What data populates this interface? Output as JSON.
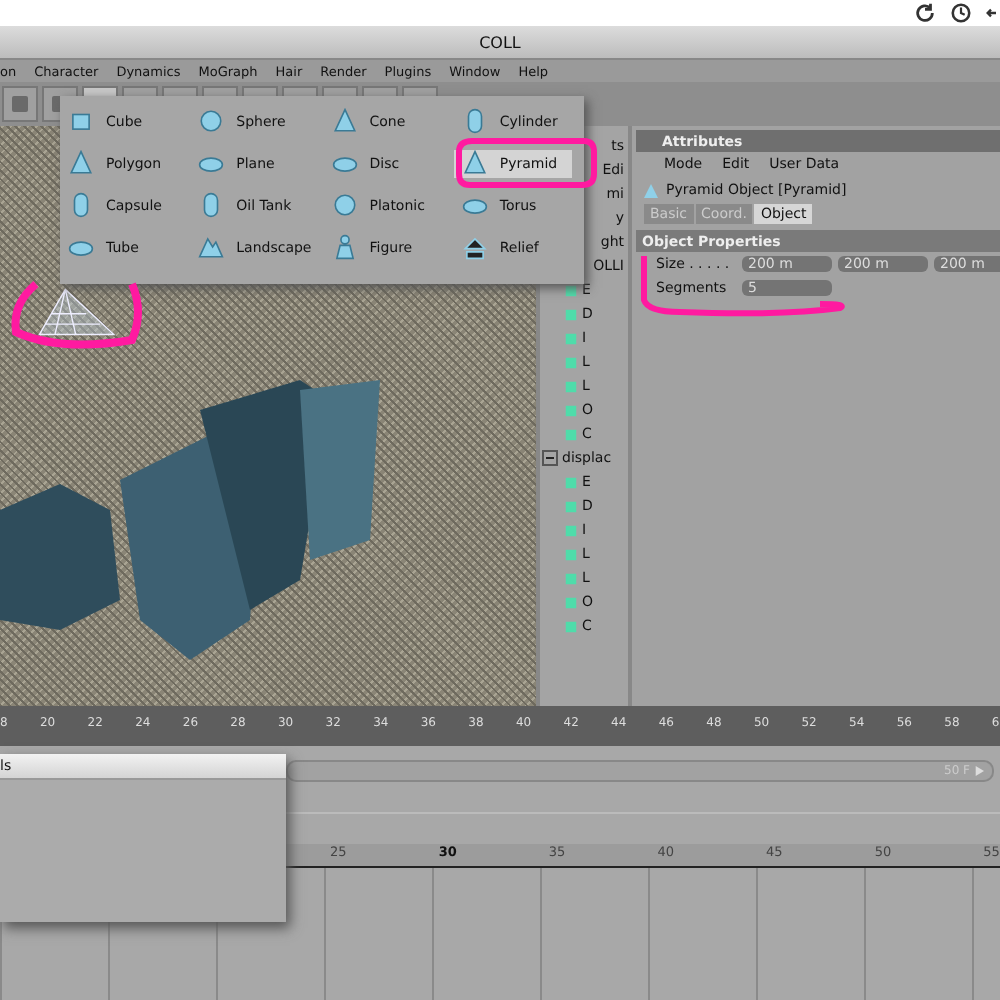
{
  "window": {
    "title": "COLL"
  },
  "menu": [
    "on",
    "Character",
    "Dynamics",
    "MoGraph",
    "Hair",
    "Render",
    "Plugins",
    "Window",
    "Help"
  ],
  "create_menu": {
    "columns": [
      [
        {
          "label": "Cube",
          "selected": false
        },
        {
          "label": "Polygon",
          "selected": false
        },
        {
          "label": "Capsule",
          "selected": false
        },
        {
          "label": "Tube",
          "selected": false
        }
      ],
      [
        {
          "label": "Sphere",
          "selected": false
        },
        {
          "label": "Plane",
          "selected": false
        },
        {
          "label": "Oil Tank",
          "selected": false
        },
        {
          "label": "Landscape",
          "selected": false
        }
      ],
      [
        {
          "label": "Cone",
          "selected": false
        },
        {
          "label": "Disc",
          "selected": false
        },
        {
          "label": "Platonic",
          "selected": false
        },
        {
          "label": "Figure",
          "selected": false
        }
      ],
      [
        {
          "label": "Cylinder",
          "selected": false
        },
        {
          "label": "Pyramid",
          "selected": true
        },
        {
          "label": "Torus",
          "selected": false
        },
        {
          "label": "Relief",
          "selected": false
        }
      ]
    ]
  },
  "object_manager": {
    "fragments": [
      "ts",
      "Edi",
      "mi",
      "y",
      "ght"
    ],
    "tree": [
      {
        "label": "OLLI",
        "children": [
          {
            "label": "E"
          },
          {
            "label": "D"
          },
          {
            "label": "I"
          },
          {
            "label": "L"
          },
          {
            "label": "L"
          },
          {
            "label": "O"
          },
          {
            "label": "C"
          }
        ]
      },
      {
        "label": "displac",
        "expanded": true,
        "children": [
          {
            "label": "E"
          },
          {
            "label": "D"
          },
          {
            "label": "I"
          },
          {
            "label": "L"
          },
          {
            "label": "L"
          },
          {
            "label": "O"
          },
          {
            "label": "C"
          }
        ]
      }
    ]
  },
  "attributes": {
    "title": "Attributes",
    "menu": [
      "Mode",
      "Edit",
      "User Data"
    ],
    "object": "Pyramid Object [Pyramid]",
    "tabs": [
      {
        "label": "Basic",
        "selected": false
      },
      {
        "label": "Coord.",
        "selected": false
      },
      {
        "label": "Object",
        "selected": true
      }
    ],
    "section": "Object Properties",
    "fields": [
      {
        "label": "Size . . . . .",
        "values": [
          "200 m",
          "200 m",
          "200 m"
        ]
      },
      {
        "label": "Segments",
        "values": [
          "5"
        ]
      }
    ]
  },
  "ruler": [
    "8",
    "20",
    "22",
    "24",
    "26",
    "28",
    "30",
    "32",
    "34",
    "36",
    "38",
    "40",
    "42",
    "44",
    "46",
    "48",
    "50",
    "52",
    "54",
    "56",
    "58",
    "6"
  ],
  "timeline": {
    "range": {
      "level": 1
    },
    "end_frame": "50 F",
    "frames": [
      {
        "label": "25",
        "current": false
      },
      {
        "label": "30",
        "current": true
      },
      {
        "label": "35",
        "current": false
      },
      {
        "label": "40",
        "current": false
      },
      {
        "label": "45",
        "current": false
      },
      {
        "label": "50",
        "current": false
      },
      {
        "label": "55",
        "current": false
      }
    ]
  },
  "floating_window": {
    "title": "ls"
  }
}
